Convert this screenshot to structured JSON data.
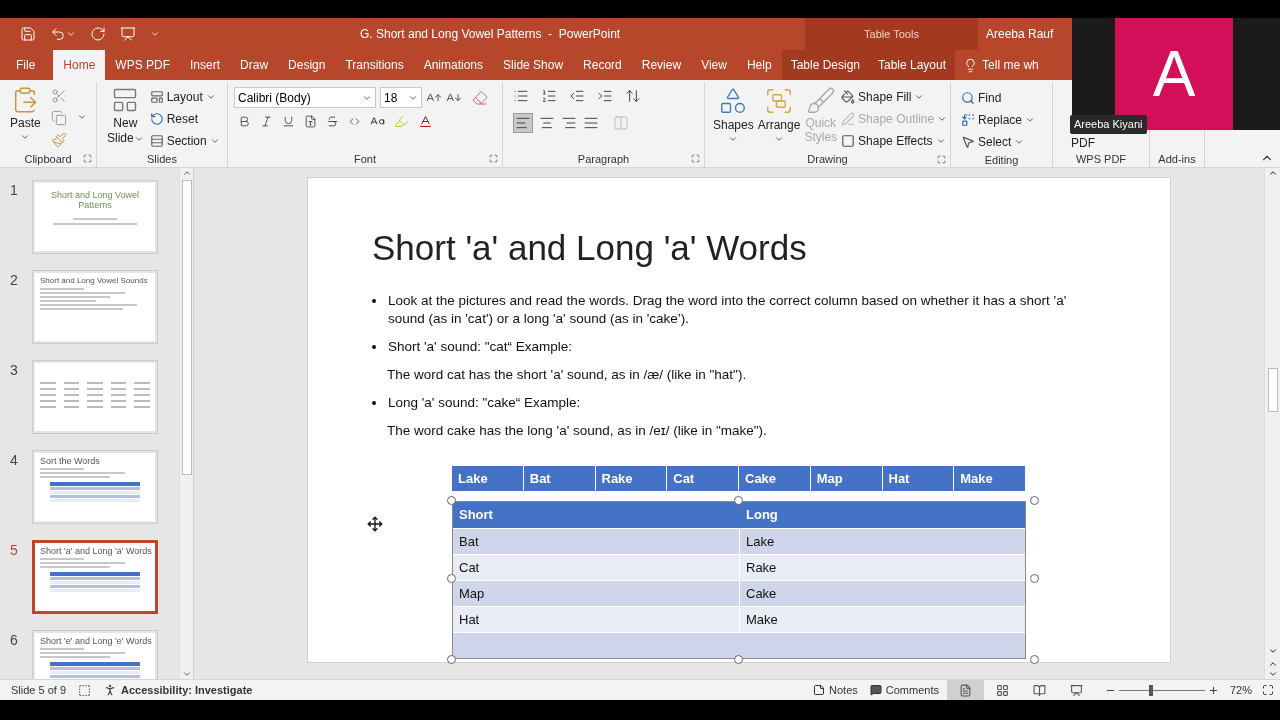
{
  "window": {
    "title": "G. Short and Long Vowel Patterns  -  PowerPoint",
    "contextual_title": "Table Tools",
    "user": "Areeba Rauf"
  },
  "tabs": [
    {
      "label": "File",
      "selected": false,
      "kind": "file"
    },
    {
      "label": "Home",
      "selected": true,
      "kind": "normal"
    },
    {
      "label": "WPS PDF",
      "selected": false,
      "kind": "normal"
    },
    {
      "label": "Insert",
      "selected": false,
      "kind": "normal"
    },
    {
      "label": "Draw",
      "selected": false,
      "kind": "normal"
    },
    {
      "label": "Design",
      "selected": false,
      "kind": "normal"
    },
    {
      "label": "Transitions",
      "selected": false,
      "kind": "normal"
    },
    {
      "label": "Animations",
      "selected": false,
      "kind": "normal"
    },
    {
      "label": "Slide Show",
      "selected": false,
      "kind": "normal"
    },
    {
      "label": "Record",
      "selected": false,
      "kind": "normal"
    },
    {
      "label": "Review",
      "selected": false,
      "kind": "normal"
    },
    {
      "label": "View",
      "selected": false,
      "kind": "normal"
    },
    {
      "label": "Help",
      "selected": false,
      "kind": "normal"
    },
    {
      "label": "Table Design",
      "selected": false,
      "kind": "contextual"
    },
    {
      "label": "Table Layout",
      "selected": false,
      "kind": "contextual"
    }
  ],
  "tell_me": "Tell me wh",
  "ribbon": {
    "clipboard": {
      "label": "Clipboard",
      "paste": "Paste"
    },
    "slides": {
      "label": "Slides",
      "new_slide": [
        "New",
        "Slide"
      ],
      "layout": "Layout",
      "reset": "Reset",
      "section": "Section"
    },
    "font": {
      "label": "Font",
      "name": "Calibri (Body)",
      "size": "18"
    },
    "paragraph": {
      "label": "Paragraph",
      "align_left_selected": true
    },
    "drawing": {
      "label": "Drawing",
      "shapes": "Shapes",
      "arrange": "Arrange",
      "quick_styles": {
        "lines": [
          "Quick",
          "Styles"
        ],
        "disabled": true
      },
      "options": [
        {
          "label": "Shape Fill",
          "disabled": false,
          "kind": "fill"
        },
        {
          "label": "Shape Outline",
          "disabled": true,
          "kind": "outline"
        },
        {
          "label": "Shape Effects",
          "disabled": false,
          "kind": "effects"
        }
      ]
    },
    "editing": {
      "label": "Editing",
      "find": "Find",
      "replace": "Replace",
      "select": "Select"
    },
    "wps_pdf": {
      "label": "WPS PDF",
      "button": "PDF"
    },
    "addins": {
      "label": "Add-ins"
    }
  },
  "webcam": {
    "initial": "A",
    "name": "Areeba Kiyani"
  },
  "slides_panel": [
    {
      "number": "1",
      "title": "Short and Long Vowel Patterns",
      "selected": false,
      "kind": "title"
    },
    {
      "number": "2",
      "title": "Short and Long Vowel Sounds",
      "selected": false,
      "kind": "list"
    },
    {
      "number": "3",
      "selected": false,
      "kind": "grid"
    },
    {
      "number": "4",
      "title": "Sort the Words",
      "selected": false,
      "kind": "table"
    },
    {
      "number": "5",
      "title": "Short 'a' and Long 'a' Words",
      "selected": true,
      "kind": "table"
    },
    {
      "number": "6",
      "title": "Short 'e' and Long 'e' Words",
      "selected": false,
      "kind": "table"
    }
  ],
  "slide": {
    "title": "Short 'a' and Long 'a' Words",
    "body": [
      {
        "kind": "bullet",
        "text": "Look at the pictures and read the words. Drag the word into the correct column based on whether it has a short 'a' sound (as in 'cat') or a long 'a' sound (as in 'cake’)."
      },
      {
        "kind": "bullet",
        "text": "Short 'a' sound: \"cat“ Example:"
      },
      {
        "kind": "plain",
        "text": "The word cat has the short 'a' sound, as in /æ/ (like in \"hat\")."
      },
      {
        "kind": "bullet",
        "text": "Long 'a' sound: \"cake“ Example:"
      },
      {
        "kind": "plain",
        "text": "The word cake has the long 'a' sound, as in /eɪ/ (like in \"make\")."
      }
    ],
    "word_bank": [
      "Lake",
      "Bat",
      "Rake",
      "Cat",
      "Cake",
      "Map",
      "Hat",
      "Make"
    ],
    "table": {
      "columns": [
        "Short",
        "Long"
      ],
      "rows": [
        [
          "Bat",
          "Lake"
        ],
        [
          "Cat",
          "Rake"
        ],
        [
          "Map",
          "Cake"
        ],
        [
          "Hat",
          "Make"
        ]
      ]
    }
  },
  "status_bar": {
    "slide": "Slide 5 of 9",
    "accessibility": "Accessibility: Investigate",
    "notes": "Notes",
    "comments": "Comments",
    "views": [
      {
        "kind": "normal",
        "selected": true
      },
      {
        "kind": "sorter",
        "selected": false
      },
      {
        "kind": "reading",
        "selected": false
      },
      {
        "kind": "slideshow",
        "selected": false
      }
    ],
    "zoom": {
      "level": 0.37,
      "reading": "72%"
    }
  }
}
